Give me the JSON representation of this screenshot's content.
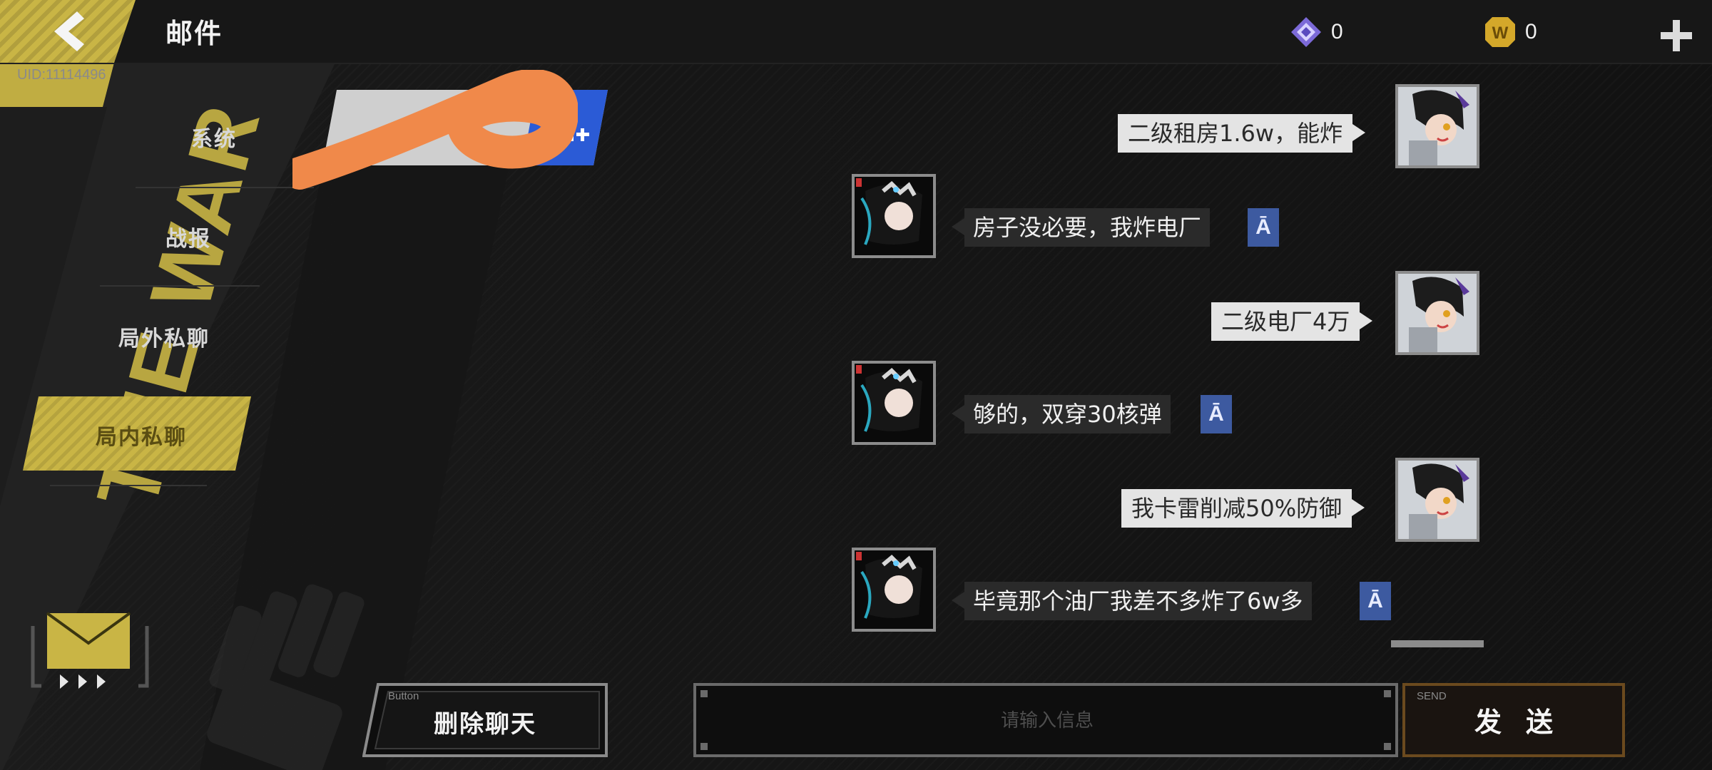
{
  "header": {
    "title": "邮件",
    "uid": "UID:11114496",
    "currencies": [
      {
        "icon": "crystal-icon",
        "value": "0"
      },
      {
        "icon": "w-coin-icon",
        "value": "0"
      }
    ]
  },
  "sidebar": {
    "items": [
      {
        "label": "系统",
        "active": false
      },
      {
        "label": "战报",
        "active": false
      },
      {
        "label": "局外私聊",
        "active": false
      },
      {
        "label": "局内私聊",
        "active": true
      }
    ]
  },
  "chat": {
    "messages": [
      {
        "side": "right",
        "text": "二级租房1.6w，能炸"
      },
      {
        "side": "left",
        "text": "房子没必要，我炸电厂",
        "translate": "Ā"
      },
      {
        "side": "right",
        "text": "二级电厂4万"
      },
      {
        "side": "left",
        "text": "够的，双穿30核弹",
        "translate": "Ā"
      },
      {
        "side": "right",
        "text": "我卡雷削减50%防御"
      },
      {
        "side": "left",
        "text": "毕竟那个油厂我差不多炸了6w多",
        "translate": "Ā"
      }
    ]
  },
  "footer": {
    "delete_tag": "Button",
    "delete_label": "删除聊天",
    "input_placeholder": "请输入信息",
    "send_tag": "SEND",
    "send_label": "发送"
  },
  "colors": {
    "accent": "#c9b545",
    "translate": "#3d5aa0",
    "send_border": "#6b4a1e"
  }
}
